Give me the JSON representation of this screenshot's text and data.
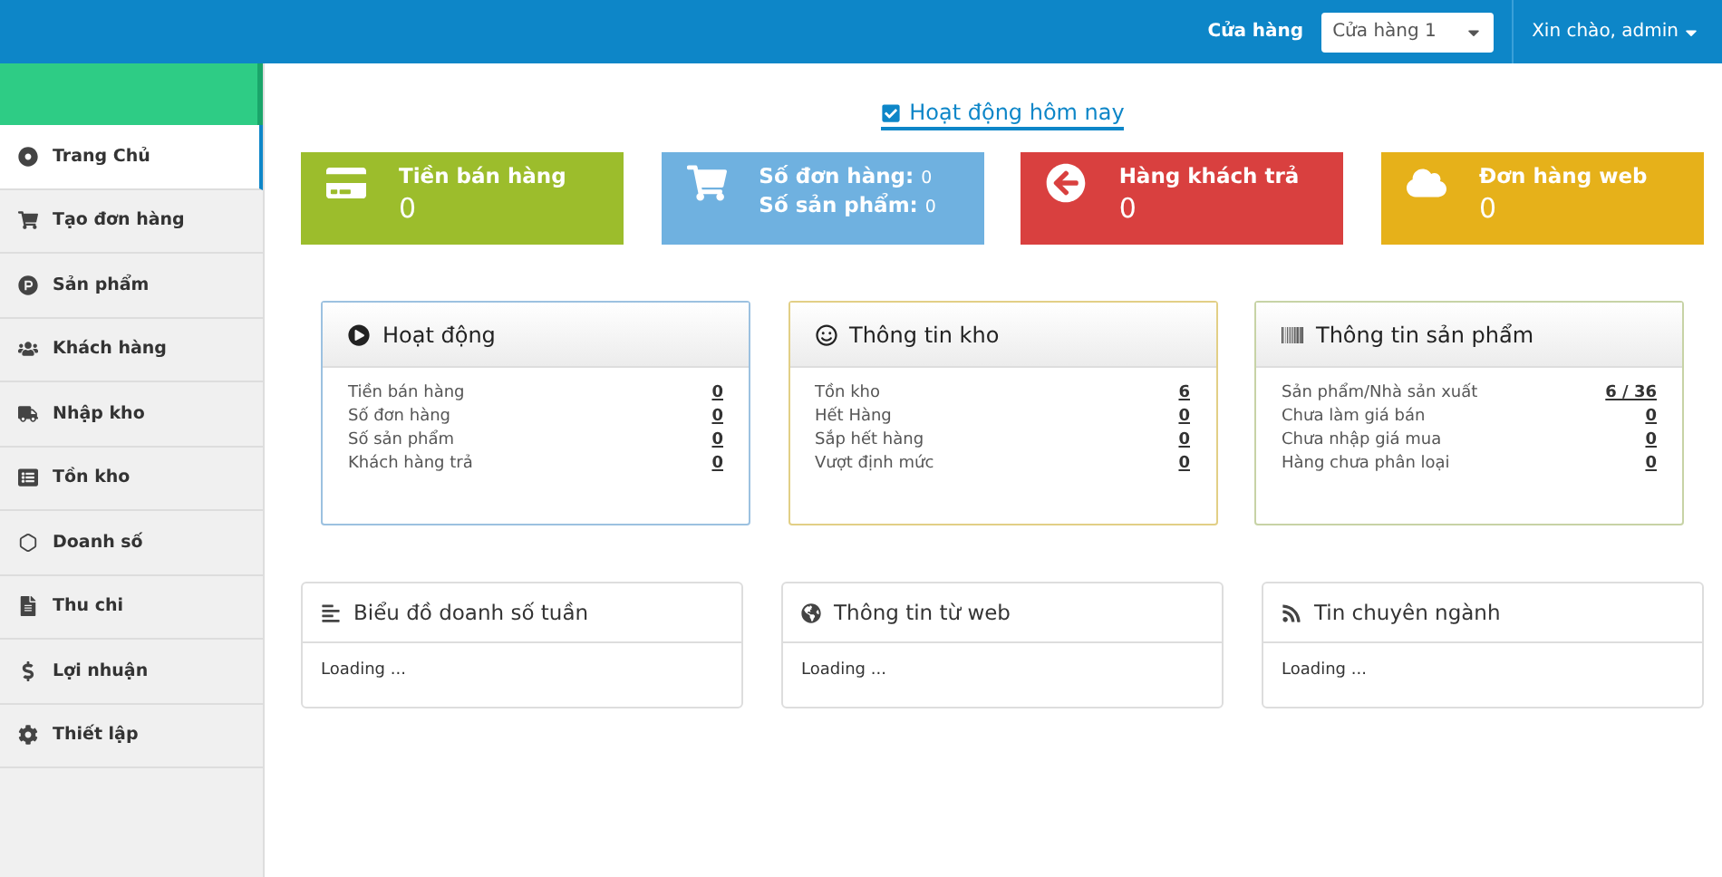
{
  "topbar": {
    "store_label": "Cửa hàng",
    "store_select": "Cửa hàng 1",
    "user_menu": "Xin chào, admin"
  },
  "sidebar": {
    "items": [
      {
        "label": "Trang Chủ",
        "selected": true
      },
      {
        "label": "Tạo đơn hàng",
        "selected": false
      },
      {
        "label": "Sản phẩm",
        "selected": false
      },
      {
        "label": "Khách hàng",
        "selected": false
      },
      {
        "label": "Nhập kho",
        "selected": false
      },
      {
        "label": "Tồn kho",
        "selected": false
      },
      {
        "label": "Doanh số",
        "selected": false
      },
      {
        "label": "Thu chi",
        "selected": false
      },
      {
        "label": "Lợi nhuận",
        "selected": false
      },
      {
        "label": "Thiết lập",
        "selected": false
      }
    ]
  },
  "today": {
    "label": "Hoạt động hôm nay",
    "checked": true
  },
  "stat_cards": [
    {
      "color": "#9cbd2c",
      "lines": [
        {
          "kind": "title",
          "label": "Tiền bán hàng"
        },
        {
          "kind": "value",
          "label": "0"
        }
      ]
    },
    {
      "color": "#6fb1e0",
      "lines": [
        {
          "kind": "pair",
          "label": "Số đơn hàng:",
          "value": "0"
        },
        {
          "kind": "pair",
          "label": "Số sản phẩm:",
          "value": "0"
        }
      ]
    },
    {
      "color": "#d9403f",
      "lines": [
        {
          "kind": "title",
          "label": "Hàng khách trả"
        },
        {
          "kind": "value",
          "label": "0"
        }
      ]
    },
    {
      "color": "#e6b11a",
      "lines": [
        {
          "kind": "title",
          "label": "Đơn hàng web"
        },
        {
          "kind": "value",
          "label": "0"
        }
      ]
    }
  ],
  "info_panels": [
    {
      "title": "Hoạt động",
      "color": "#9cc1e0",
      "rows": [
        {
          "label": "Tiền bán hàng",
          "value": "0"
        },
        {
          "label": "Số đơn hàng",
          "value": "0"
        },
        {
          "label": "Số sản phẩm",
          "value": "0"
        },
        {
          "label": "Khách hàng trả",
          "value": "0"
        }
      ]
    },
    {
      "title": "Thông tin kho",
      "color": "#e2cf86",
      "rows": [
        {
          "label": "Tồn kho",
          "value": "6"
        },
        {
          "label": "Hết Hàng",
          "value": "0"
        },
        {
          "label": "Sắp hết hàng",
          "value": "0"
        },
        {
          "label": "Vượt định mức",
          "value": "0"
        }
      ]
    },
    {
      "title": "Thông tin sản phẩm",
      "color": "#c7d3a6",
      "rows": [
        {
          "label": "Sản phẩm/Nhà sản xuất",
          "value": "6 / 36"
        },
        {
          "label": "Chưa làm giá bán",
          "value": "0"
        },
        {
          "label": "Chưa nhập giá mua",
          "value": "0"
        },
        {
          "label": "Hàng chưa phân loại",
          "value": "0"
        }
      ]
    }
  ],
  "widgets": [
    {
      "title": "Biểu đồ doanh số tuần",
      "body": "Loading ..."
    },
    {
      "title": "Thông tin từ web",
      "body": "Loading ..."
    },
    {
      "title": "Tin chuyên ngành",
      "body": "Loading ..."
    }
  ]
}
